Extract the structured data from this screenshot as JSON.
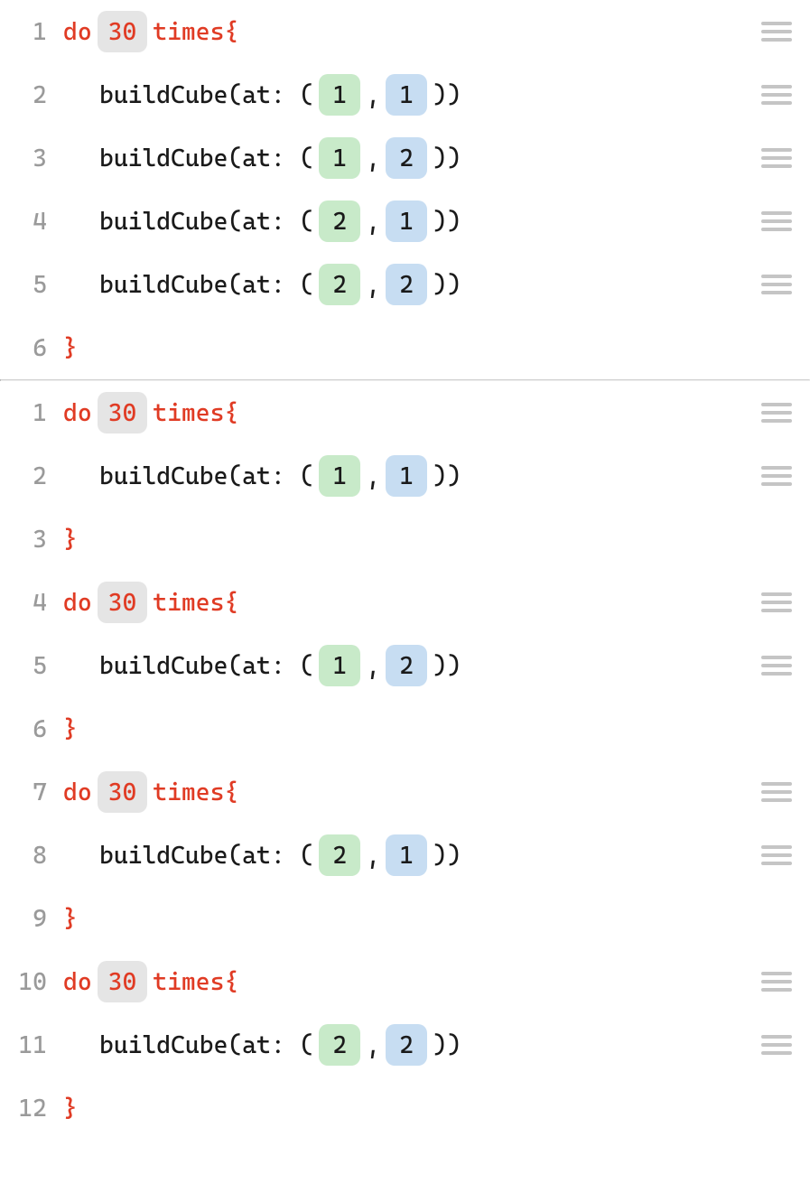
{
  "kw_do": "do",
  "kw_times_open": "times{",
  "kw_close": "}",
  "fn_prefix": "buildCube(at: (",
  "comma": ",",
  "fn_suffix": "))",
  "panels": [
    {
      "lines": [
        {
          "n": "1",
          "type": "do",
          "count": "30"
        },
        {
          "n": "2",
          "type": "call",
          "x": "1",
          "y": "1"
        },
        {
          "n": "3",
          "type": "call",
          "x": "1",
          "y": "2"
        },
        {
          "n": "4",
          "type": "call",
          "x": "2",
          "y": "1"
        },
        {
          "n": "5",
          "type": "call",
          "x": "2",
          "y": "2"
        },
        {
          "n": "6",
          "type": "close"
        }
      ]
    },
    {
      "lines": [
        {
          "n": "1",
          "type": "do",
          "count": "30"
        },
        {
          "n": "2",
          "type": "call",
          "x": "1",
          "y": "1"
        },
        {
          "n": "3",
          "type": "close"
        },
        {
          "n": "4",
          "type": "do",
          "count": "30"
        },
        {
          "n": "5",
          "type": "call",
          "x": "1",
          "y": "2"
        },
        {
          "n": "6",
          "type": "close"
        },
        {
          "n": "7",
          "type": "do",
          "count": "30"
        },
        {
          "n": "8",
          "type": "call",
          "x": "2",
          "y": "1"
        },
        {
          "n": "9",
          "type": "close"
        },
        {
          "n": "10",
          "type": "do",
          "count": "30"
        },
        {
          "n": "11",
          "type": "call",
          "x": "2",
          "y": "2"
        },
        {
          "n": "12",
          "type": "close"
        }
      ]
    }
  ]
}
